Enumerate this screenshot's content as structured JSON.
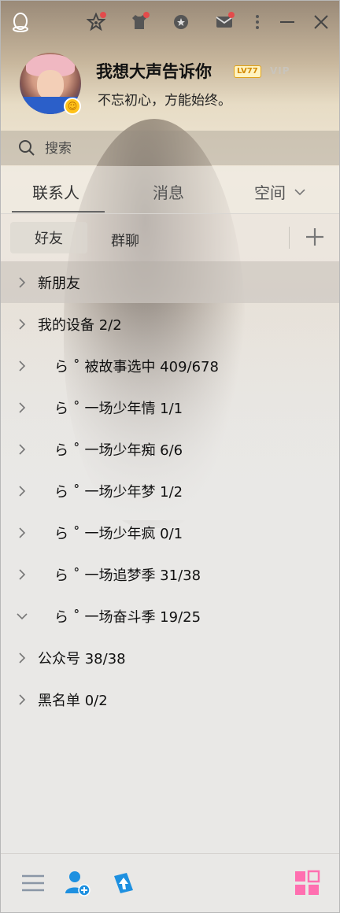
{
  "titlebar": {
    "icons": [
      "qq-penguin-icon",
      "star-notify-icon",
      "shirt-icon",
      "medal-icon",
      "mail-icon",
      "more-icon",
      "minimize-icon",
      "close-icon"
    ]
  },
  "profile": {
    "nickname": "我想大声告诉你",
    "level_badge": "LV77",
    "vip_badge": "VIP",
    "signature": "不忘初心，方能始终。"
  },
  "search": {
    "placeholder": "搜索"
  },
  "tabs": [
    {
      "label": "联系人",
      "active": true
    },
    {
      "label": "消息",
      "active": false
    },
    {
      "label": "空间",
      "active": false
    }
  ],
  "subtabs": {
    "friends": "好友",
    "groups": "群聊"
  },
  "groups": [
    {
      "label": "新朋友",
      "expanded": false,
      "indent": false,
      "highlight": true
    },
    {
      "label": "我的设备 2/2",
      "expanded": false,
      "indent": false,
      "highlight": false
    },
    {
      "label": "ら ˚ 被故事选中 409/678",
      "expanded": false,
      "indent": true,
      "highlight": false
    },
    {
      "label": "ら ˚ 一场少年情 1/1",
      "expanded": false,
      "indent": true,
      "highlight": false
    },
    {
      "label": "ら ˚ 一场少年痴 6/6",
      "expanded": false,
      "indent": true,
      "highlight": false
    },
    {
      "label": "ら ˚ 一场少年梦 1/2",
      "expanded": false,
      "indent": true,
      "highlight": false
    },
    {
      "label": "ら ˚ 一场少年疯 0/1",
      "expanded": false,
      "indent": true,
      "highlight": false
    },
    {
      "label": "ら ˚ 一场追梦季 31/38",
      "expanded": false,
      "indent": true,
      "highlight": false
    },
    {
      "label": "ら ˚ 一场奋斗季 19/25",
      "expanded": true,
      "indent": true,
      "highlight": false
    },
    {
      "label": "公众号 38/38",
      "expanded": false,
      "indent": false,
      "highlight": false
    },
    {
      "label": "黑名单 0/2",
      "expanded": false,
      "indent": false,
      "highlight": false
    }
  ],
  "colors": {
    "accent_blue": "#1e90e0",
    "notify_red": "#e34b4b",
    "apps_pink": "#ff6fb0"
  }
}
